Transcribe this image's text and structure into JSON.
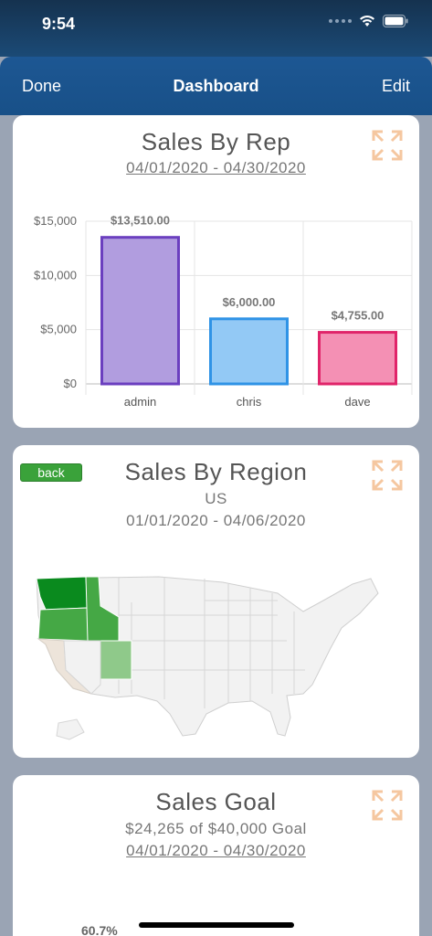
{
  "status": {
    "time": "9:54"
  },
  "nav": {
    "done": "Done",
    "title": "Dashboard",
    "edit": "Edit"
  },
  "colors": {
    "expand_icon": "#f5c7a0",
    "nav": "#1d5793",
    "map_dark": "#0a8a1e",
    "map_mid": "#45a845",
    "map_light": "#8fc98a",
    "map_beige": "#ede4da"
  },
  "card1": {
    "title": "Sales By Rep",
    "date_range": "04/01/2020 - 04/30/2020",
    "icon": "expand-icon"
  },
  "card2": {
    "back_label": "back",
    "title": "Sales By Region",
    "subtitle": "US",
    "date_range": "01/01/2020 - 04/06/2020",
    "icon": "expand-icon"
  },
  "card3": {
    "title": "Sales Goal",
    "subtitle": "$24,265 of $40,000 Goal",
    "date_range": "04/01/2020 - 04/30/2020",
    "percent_label": "60.7%",
    "progress": 0.607,
    "icon": "expand-icon"
  },
  "chart_data": {
    "type": "bar",
    "categories": [
      "admin",
      "chris",
      "dave"
    ],
    "values": [
      13510,
      6000,
      4755
    ],
    "value_labels": [
      "$13,510.00",
      "$6,000.00",
      "$4,755.00"
    ],
    "yticks": [
      "$0",
      "$5,000",
      "$10,000",
      "$15,000"
    ],
    "ytick_values": [
      0,
      5000,
      10000,
      15000
    ],
    "ylim": [
      0,
      15000
    ],
    "fill_colors": [
      "#b19ddf",
      "#93c9f5",
      "#f490b4"
    ],
    "stroke_colors": [
      "#6b3fbf",
      "#2f93e6",
      "#e0246a"
    ],
    "title": "Sales By Rep"
  }
}
